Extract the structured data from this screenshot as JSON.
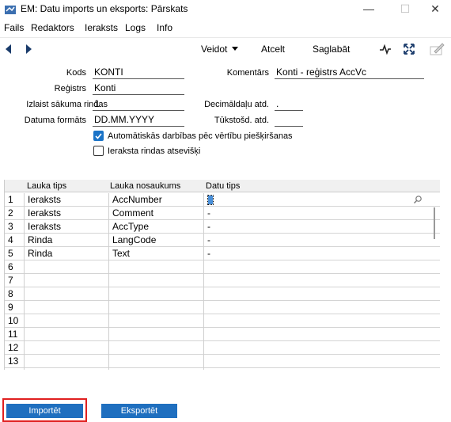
{
  "window": {
    "title": "EM: Datu imports un eksports: Pārskats",
    "minimize": "—",
    "maximize": "☐",
    "close": "✕"
  },
  "menu": [
    "Fails",
    "Redaktors",
    "Ieraksts",
    "Logs",
    "Info"
  ],
  "toolbar": {
    "create_label": "Veidot",
    "cancel_label": "Atcelt",
    "save_label": "Saglabāt"
  },
  "form": {
    "kods_label": "Kods",
    "kods_value": "KONTI",
    "komentars_label": "Komentārs",
    "komentars_value": "Konti - reģistrs AccVc",
    "registrs_label": "Reģistrs",
    "registrs_value": "Konti",
    "start_row_label": "Izlaist sākuma rindas",
    "start_row_value": "1",
    "decimals_label": "Decimāldaļu atd.",
    "decimals_value": ".",
    "date_format_label": "Datuma formāts",
    "date_format_value": "DD.MM.YYYY",
    "thousands_label": "Tūkstošd. atd.",
    "thousands_value": "",
    "auto_actions_label": "Automātiskās darbības pēc vērtību piešķiršanas",
    "auto_actions_checked": true,
    "separate_rows_label": "Ieraksta rindas atsevišķi",
    "separate_rows_checked": false
  },
  "grid": {
    "columns": [
      "Lauka tips",
      "Lauka nosaukums",
      "Datu tips"
    ],
    "rows": [
      {
        "num": "1",
        "type": "Ieraksts",
        "name": "AccNumber",
        "data": ""
      },
      {
        "num": "2",
        "type": "Ieraksts",
        "name": "Comment",
        "data": "-"
      },
      {
        "num": "3",
        "type": "Ieraksts",
        "name": "AccType",
        "data": "-"
      },
      {
        "num": "4",
        "type": "Rinda",
        "name": "LangCode",
        "data": "-"
      },
      {
        "num": "5",
        "type": "Rinda",
        "name": "Text",
        "data": "-"
      },
      {
        "num": "6",
        "type": "",
        "name": "",
        "data": ""
      },
      {
        "num": "7",
        "type": "",
        "name": "",
        "data": ""
      },
      {
        "num": "8",
        "type": "",
        "name": "",
        "data": ""
      },
      {
        "num": "9",
        "type": "",
        "name": "",
        "data": ""
      },
      {
        "num": "10",
        "type": "",
        "name": "",
        "data": ""
      },
      {
        "num": "11",
        "type": "",
        "name": "",
        "data": ""
      },
      {
        "num": "12",
        "type": "",
        "name": "",
        "data": ""
      },
      {
        "num": "13",
        "type": "",
        "name": "",
        "data": ""
      }
    ]
  },
  "buttons": {
    "import_label": "Importēt",
    "export_label": "Eksportēt"
  },
  "colors": {
    "accent": "#1f6fbf",
    "highlight": "#e02020"
  }
}
